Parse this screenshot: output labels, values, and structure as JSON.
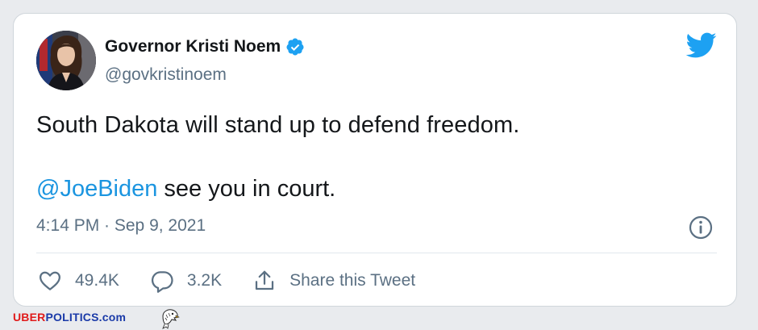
{
  "tweet": {
    "author_name": "Governor Kristi Noem",
    "handle": "@govkristinoem",
    "text_line1": "South Dakota will stand up to defend freedom.",
    "mention": "@JoeBiden",
    "text_line2_rest": " see you in court.",
    "timestamp": "4:14 PM · Sep 9, 2021"
  },
  "actions": {
    "likes": "49.4K",
    "replies": "3.2K",
    "share_label": "Share this Tweet"
  },
  "watermark": {
    "part1": "UBER",
    "part2": "POLITICS",
    "part3": ".com"
  },
  "colors": {
    "twitter_blue": "#1da1f2",
    "mention_blue": "#1b95e0",
    "brand_red": "#e01b1b",
    "brand_blue": "#1a3aa8"
  },
  "icons": {
    "brand": "twitter-bird-icon",
    "verified": "verified-badge-icon",
    "info": "info-icon",
    "like": "heart-icon",
    "reply": "speech-bubble-icon",
    "share": "share-upload-icon",
    "mascot": "eagle-icon"
  }
}
